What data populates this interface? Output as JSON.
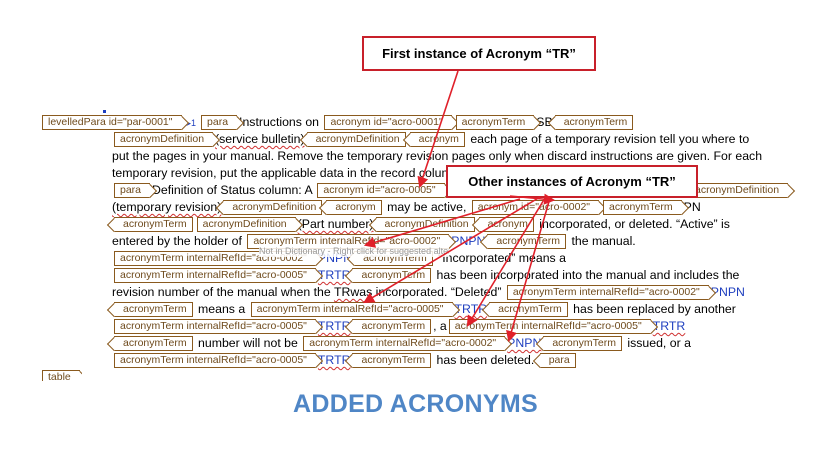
{
  "callouts": {
    "first": "First instance of Acronym “TR”",
    "other": "Other instances of Acronym “TR”"
  },
  "tooltip": "Not in Dictionary - Right click for suggested alternatives",
  "heading": "ADDED ACRONYMS",
  "tags": {
    "levelled_para": "levelledPara id=\"par-0001\"",
    "para": "para",
    "acronym_0001": "acronym id=\"acro-0001\"",
    "acronym_0005": "acronym id=\"acro-0005\"",
    "acronym_0002": "acronym id=\"acro-0002\"",
    "acronym_term": "acronymTerm",
    "acronym_definition": "acronymDefinition",
    "acronym": "acronym",
    "term_ref_0002": "acronymTerm internalRefId=\"acro-0002\"",
    "term_ref_0005": "acronymTerm internalRefId=\"acro-0005\"",
    "table": "table"
  },
  "text": {
    "instructions_on": "Instructions on",
    "sb": "SB",
    "service_bulletin": "(service bulletin)",
    "each_page": "each page of a temporary revision tell you where to",
    "line3": "put the pages in your manual. Remove the temporary revision pages only when discard instructions are given. For each",
    "line4": "temporary revision, put the applicable data in the record colum",
    "definition_of_status": "Definition of Status column: A",
    "temporary_revision": "(temporary revision)",
    "may_be_active": "may be active,",
    "pn": "PN",
    "part_number": "(Part number)",
    "incorporated": "incorporated, or deleted. “Active” is",
    "entered_by": "entered by the holder of",
    "pnpn": "PNPN",
    "the_manual": "the manual.",
    "incorporated_means": "“Incorporated” means a",
    "trtr": "TRTR",
    "has_been_incorporated": "has been incorporated into the manual and includes the",
    "revision_number": "revision number of the manual when the",
    "tr_was": "TRwas",
    "incorporated_deleted": "incorporated. “Deleted”",
    "means_a": "means a",
    "replaced_by": "has been replaced by another",
    "comma_a": ", a",
    "number_will": "number will not be",
    "issued_or": "issued, or a",
    "has_been_deleted": "has been deleted."
  },
  "colors": {
    "callout_border": "#c8202a",
    "arrow": "#e0202a",
    "tag_border": "#8a5a1e",
    "link_blue": "#1f3fbf",
    "heading": "#4f86c6"
  }
}
